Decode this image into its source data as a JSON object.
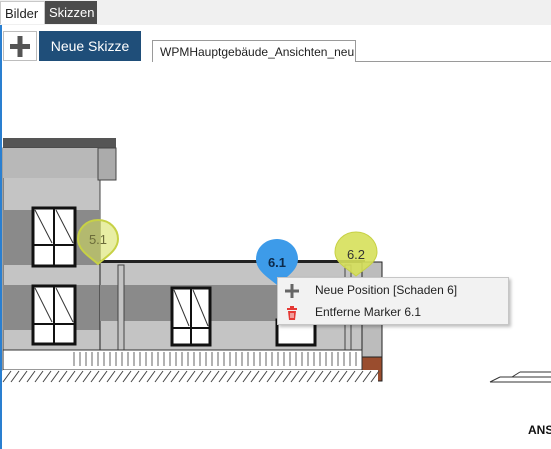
{
  "tabs": {
    "bilder": "Bilder",
    "skizzen": "Skizzen"
  },
  "toolbar": {
    "new_sketch_label": "Neue Skizze"
  },
  "document": {
    "tab_label": "WPMHauptgebäude_Ansichten_neu"
  },
  "markers": [
    {
      "id": "5.1",
      "label": "5.1",
      "color": "#d6e05a"
    },
    {
      "id": "6.1",
      "label": "6.1",
      "color": "#3d9be9"
    },
    {
      "id": "6.2",
      "label": "6.2",
      "color": "#d6e05a"
    }
  ],
  "context_menu": {
    "items": [
      {
        "label": "Neue Position [Schaden 6]",
        "icon": "plus-icon"
      },
      {
        "label": "Entferne Marker 6.1",
        "icon": "trash-icon"
      }
    ]
  },
  "drawing": {
    "corner_text": "ANS"
  }
}
